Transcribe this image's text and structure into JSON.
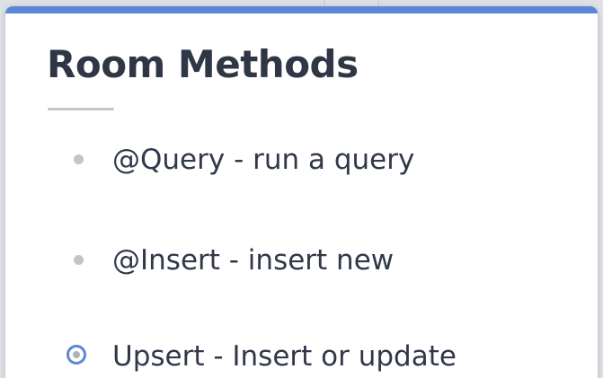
{
  "slide": {
    "title": "Room Methods",
    "items": [
      {
        "label": "@Query - run a query",
        "marker": "bullet"
      },
      {
        "label": "@Insert - insert new",
        "marker": "bullet"
      },
      {
        "label": "Upsert - Insert or update",
        "marker": "radio-selected"
      }
    ]
  },
  "colors": {
    "accent": "#5b88d6",
    "title_text": "#2f3747",
    "body_text": "#30384a",
    "bullet": "#c1c5cb",
    "underline": "#c2c6cc"
  }
}
